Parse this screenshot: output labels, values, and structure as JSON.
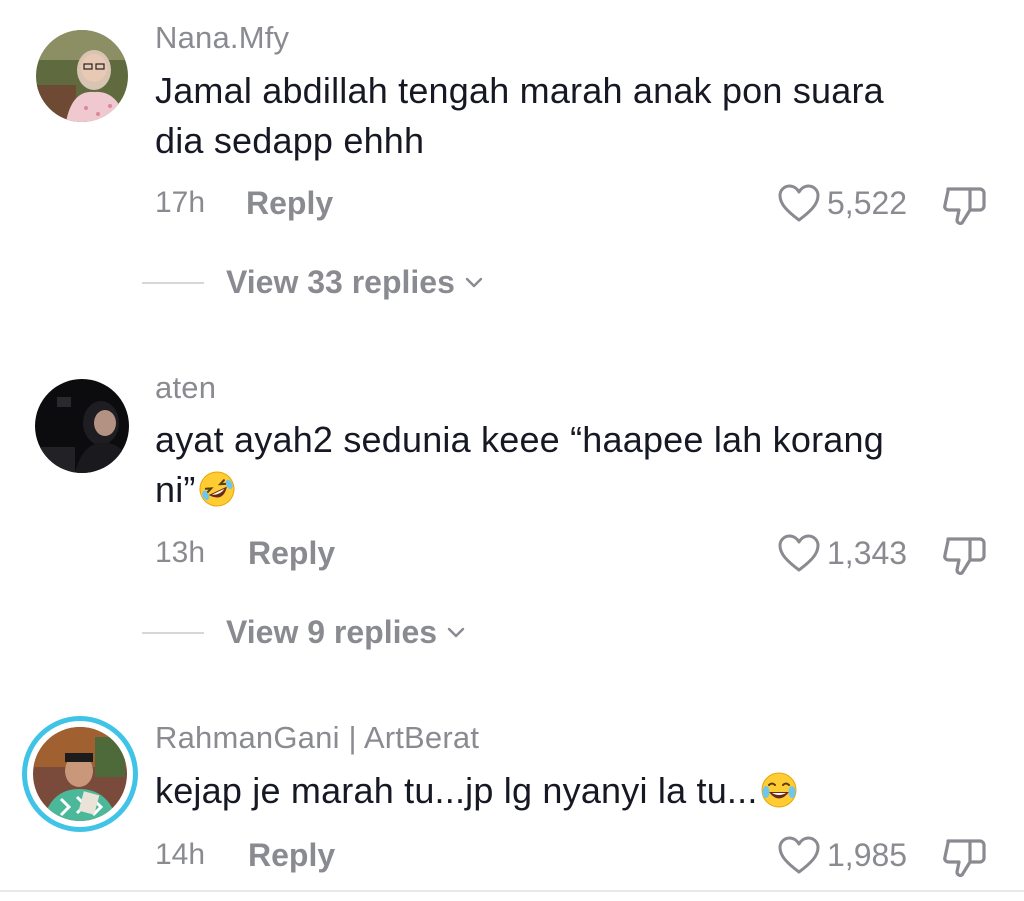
{
  "comments": [
    {
      "username": "Nana.Mfy",
      "text_line1": "Jamal abdillah tengah marah anak pon suara",
      "text_line2": "dia sedapp ehhh",
      "time": "17h",
      "reply_label": "Reply",
      "likes": "5,522",
      "view_replies": "View 33 replies"
    },
    {
      "username": "aten",
      "text_line1": "ayat ayah2 sedunia keee “haapee lah korang",
      "text_line2": "ni”",
      "emoji": "rolling-on-floor-laughing-emoji",
      "time": "13h",
      "reply_label": "Reply",
      "likes": "1,343",
      "view_replies": "View 9 replies"
    },
    {
      "username": "RahmanGani | ArtBerat",
      "text_line1": "kejap je marah tu...jp lg nyanyi la tu...",
      "emoji": "tears-of-joy-emoji",
      "time": "14h",
      "reply_label": "Reply",
      "likes": "1,985"
    }
  ],
  "icons": {
    "like": "heart-outline-icon",
    "dislike": "thumbs-down-outline-icon",
    "expand": "chevron-down-icon"
  },
  "colors": {
    "text_primary": "#161823",
    "text_secondary": "#8a8b91",
    "story_ring": "#3fc4e8"
  }
}
